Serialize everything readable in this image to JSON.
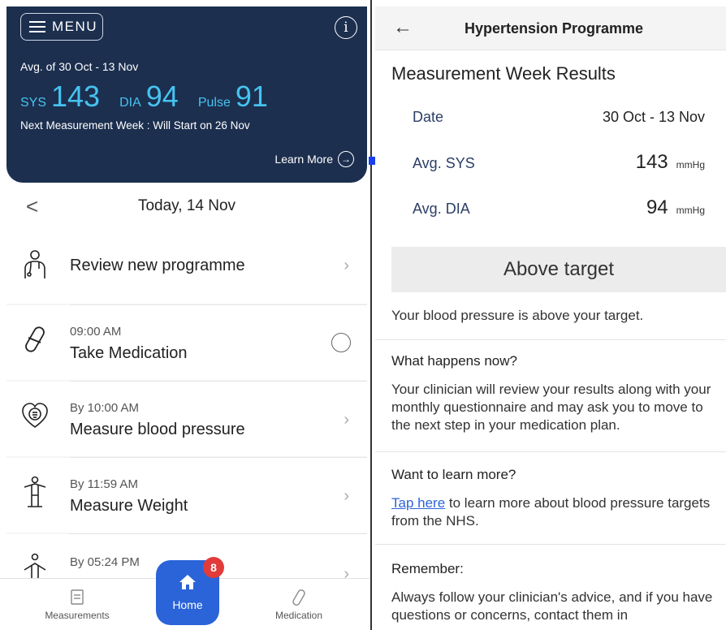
{
  "left": {
    "header": {
      "menu_label": "MENU",
      "info_icon": "info-icon",
      "avg_range": "Avg. of 30 Oct - 13 Nov",
      "sys_label": "SYS",
      "sys_value": "143",
      "dia_label": "DIA",
      "dia_value": "94",
      "pulse_label": "Pulse",
      "pulse_value": "91",
      "next_week": "Next Measurement Week : Will Start on 26 Nov",
      "learn_more": "Learn More"
    },
    "date_nav": {
      "date": "Today, 14 Nov"
    },
    "tasks": [
      {
        "time": "",
        "title": "Review new programme",
        "icon": "doctor-icon"
      },
      {
        "time": "09:00 AM",
        "title": "Take Medication",
        "icon": "pill-icon"
      },
      {
        "time": "By 10:00 AM",
        "title": "Measure blood pressure",
        "icon": "heart-icon"
      },
      {
        "time": "By 11:59 AM",
        "title": "Measure Weight",
        "icon": "person-weight-icon"
      },
      {
        "time": "By 05:24 PM",
        "title": "",
        "icon": "person-icon"
      }
    ],
    "tabbar": {
      "measurements": "Measurements",
      "home": "Home",
      "medication": "Medication",
      "badge": "8"
    }
  },
  "right": {
    "header": {
      "title": "Hypertension Programme"
    },
    "heading": "Measurement Week Results",
    "rows": {
      "date_label": "Date",
      "date_value": "30 Oct - 13 Nov",
      "sys_label": "Avg. SYS",
      "sys_value": "143",
      "dia_label": "Avg. DIA",
      "dia_value": "94",
      "unit": "mmHg"
    },
    "status": "Above target",
    "status_text": "Your blood pressure is above your target.",
    "what_happens": {
      "heading": "What happens now?",
      "body": "Your clinician will review your results along with your monthly questionnaire and may ask you to move to the next step in your medication plan."
    },
    "learn_more": {
      "heading": "Want to learn more?",
      "link": "Tap here",
      "body": " to learn more about blood pressure targets from the NHS."
    },
    "remember": {
      "heading": "Remember:",
      "body": "Always follow your clinician's advice, and if you have questions or concerns, contact them in"
    }
  },
  "colors": {
    "header_bg": "#1c2f4f",
    "vital_blue": "#46c3f0",
    "accent": "#2b63d9",
    "badge": "#e23b3b"
  }
}
